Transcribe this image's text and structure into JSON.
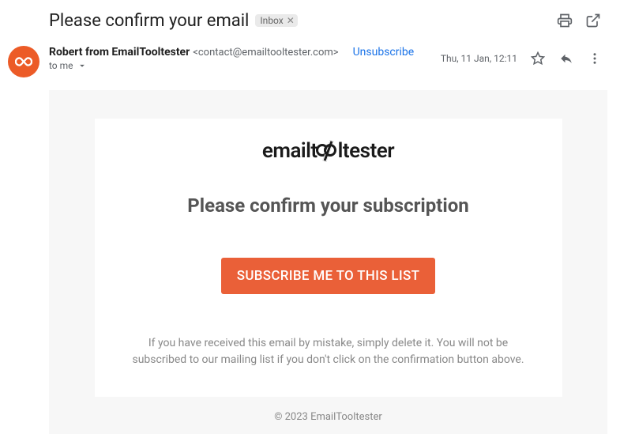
{
  "header": {
    "subject": "Please confirm your email",
    "label": "Inbox"
  },
  "sender": {
    "name": "Robert from EmailTooltester",
    "email": "<contact@emailtooltester.com>",
    "unsubscribe": "Unsubscribe",
    "to": "to me",
    "date": "Thu, 11 Jan, 12:11"
  },
  "body": {
    "logo_pre": "emailt",
    "logo_post": "ltester",
    "heading": "Please confirm your subscription",
    "cta": "SUBSCRIBE ME TO THIS LIST",
    "disclaimer": "If you have received this email by mistake, simply delete it. You will not be subscribed to our mailing list if you don't click on the confirmation button above.",
    "footer": "© 2023 EmailTooltester"
  }
}
